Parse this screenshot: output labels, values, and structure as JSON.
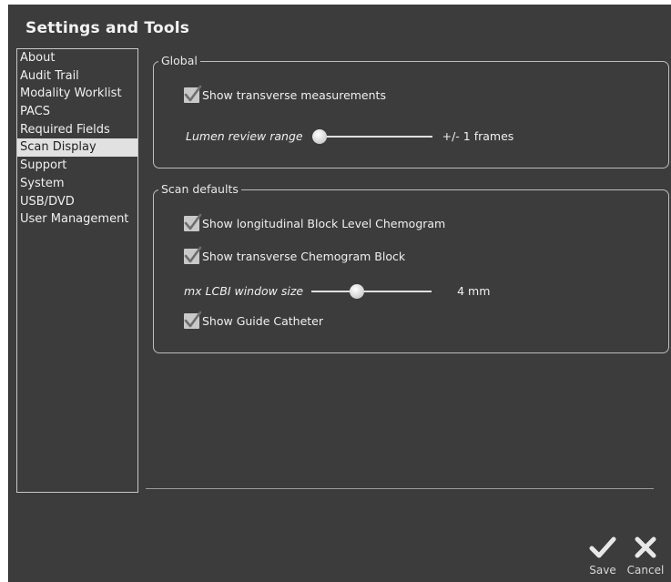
{
  "window": {
    "title": "Settings and Tools"
  },
  "sidebar": {
    "items": [
      {
        "label": "About",
        "selected": false
      },
      {
        "label": "Audit Trail",
        "selected": false
      },
      {
        "label": "Modality Worklist",
        "selected": false
      },
      {
        "label": "PACS",
        "selected": false
      },
      {
        "label": "Required Fields",
        "selected": false
      },
      {
        "label": "Scan Display",
        "selected": true
      },
      {
        "label": "Support",
        "selected": false
      },
      {
        "label": "System",
        "selected": false
      },
      {
        "label": "USB/DVD",
        "selected": false
      },
      {
        "label": "User Management",
        "selected": false
      }
    ]
  },
  "global": {
    "legend": "Global",
    "show_transverse": {
      "label": "Show transverse measurements",
      "checked": true
    },
    "lumen": {
      "label": "Lumen review range",
      "value_text": "+/- 1 frames",
      "level": 0.0
    }
  },
  "scan_defaults": {
    "legend": "Scan defaults",
    "show_longitudinal": {
      "label": "Show longitudinal Block Level Chemogram",
      "checked": true
    },
    "show_transverse_block": {
      "label": "Show transverse Chemogram Block",
      "checked": true
    },
    "lcbi": {
      "label": "mx LCBI window size",
      "value_text": "4 mm",
      "level": 0.36
    },
    "show_guide": {
      "label": "Show Guide Catheter",
      "checked": true
    }
  },
  "actions": {
    "save": {
      "label": "Save",
      "icon": "checkmark-icon"
    },
    "cancel": {
      "label": "Cancel",
      "icon": "x-icon"
    }
  },
  "colors": {
    "background": "#3c3c3c",
    "selection": "#e1e1e1",
    "checkbox": "#c9c9c9",
    "checkmark": "#6e6e6e"
  }
}
